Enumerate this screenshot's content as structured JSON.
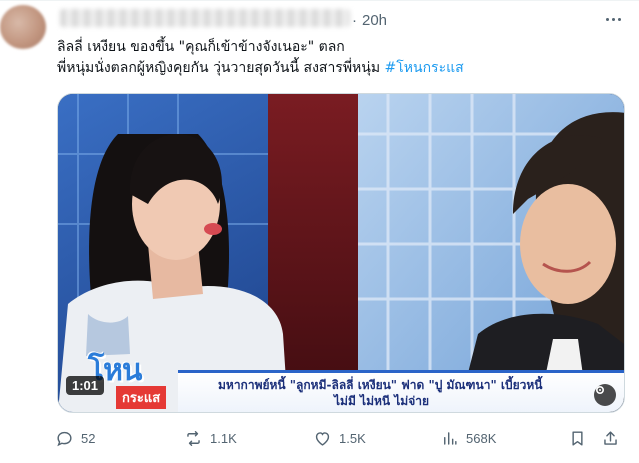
{
  "tweet": {
    "time": "20h",
    "dot": "·",
    "text_line1": "ลิลลี่ เหงียน ของขึ้น \"คุณก็เข้าข้างจังเนอะ\" ตลก",
    "text_line2": "พี่หนุ่มนั่งตลกผู้หญิงคุยกัน วุ่นวายสุดวันนี้ สงสารพี่หนุ่ม ",
    "hashtag": "#โหนกระแส"
  },
  "media": {
    "duration": "1:01",
    "logo_main": "โหน",
    "logo_sub": "กระแส",
    "caption_line1": "มหากาพย์หนี้ \"ลูกหมี-ลิลลี่ เหงียน\" ฟาด \"ปู มัณฑนา\" เบี้ยวหนี้",
    "caption_line2": "ไม่มี ไม่หนี ไม่จ่าย"
  },
  "actions": {
    "replies": "52",
    "reposts": "1.1K",
    "likes": "1.5K",
    "views": "568K"
  },
  "icons": [
    "more-icon",
    "reply-icon",
    "repost-icon",
    "like-icon",
    "views-icon",
    "bookmark-icon",
    "share-icon",
    "settings-icon"
  ],
  "colors": {
    "text": "#0f1419",
    "muted": "#536471",
    "link": "#1d9bf0"
  }
}
